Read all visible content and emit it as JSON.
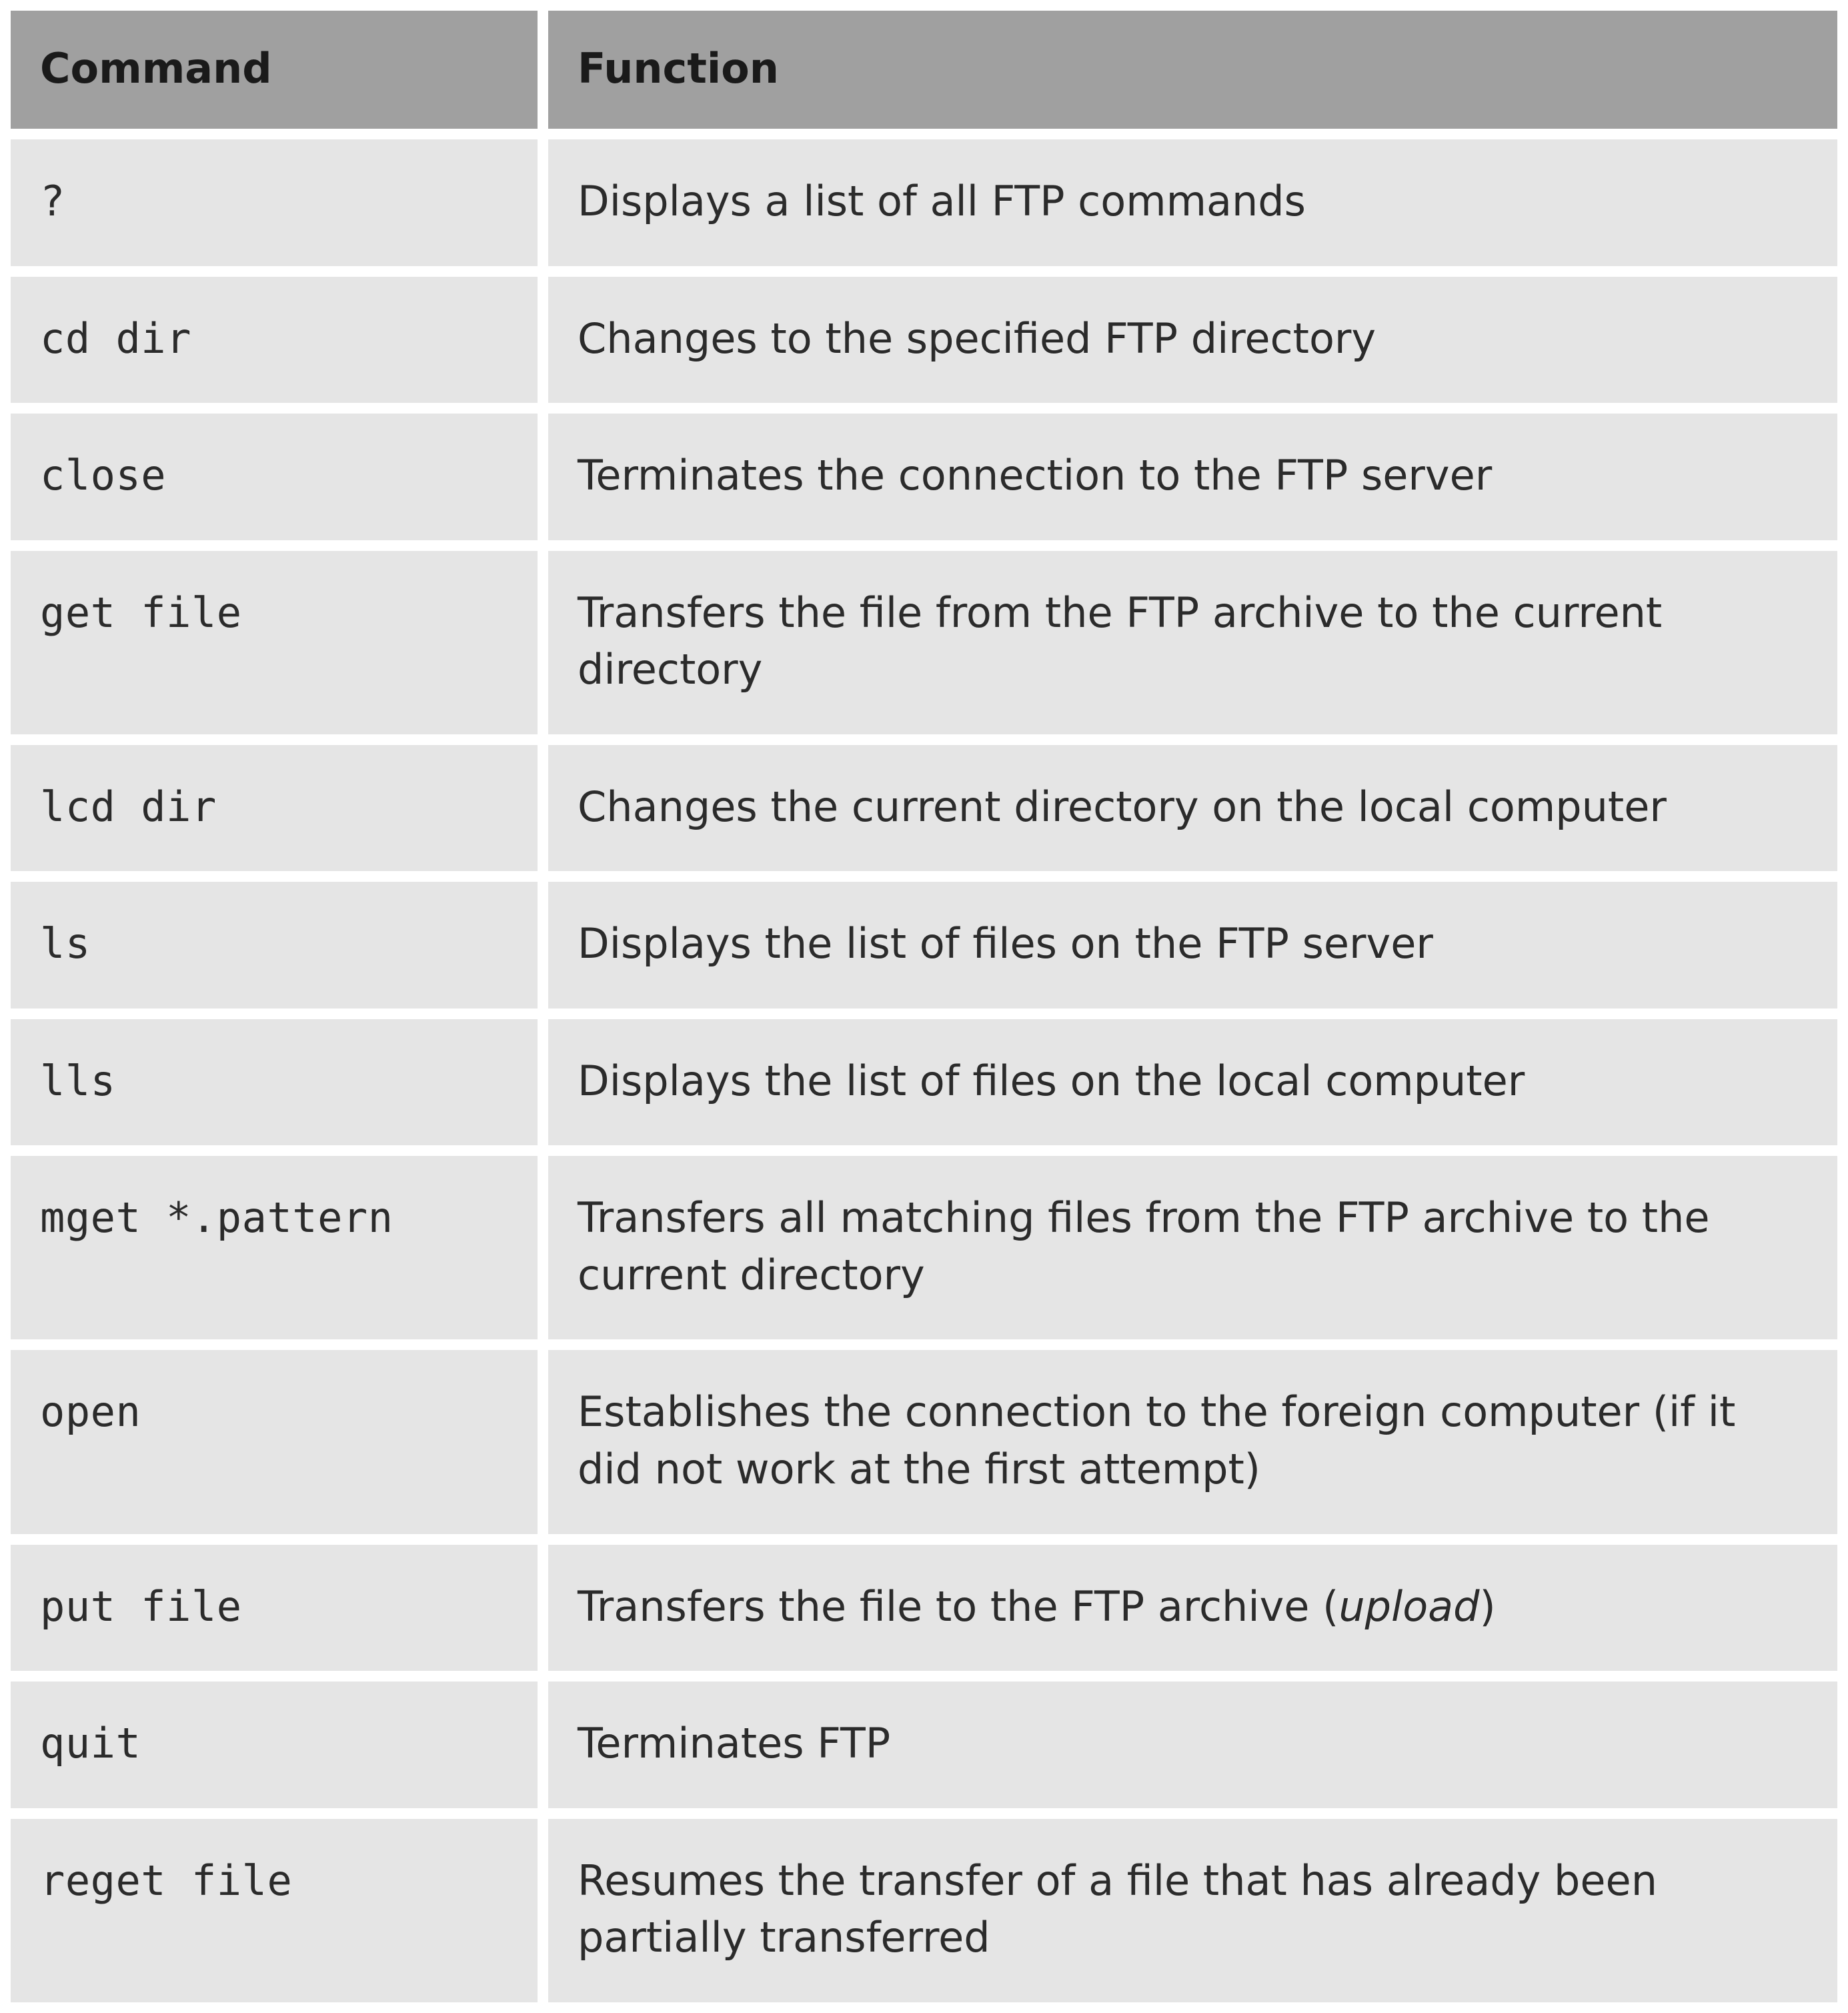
{
  "table": {
    "headers": {
      "command": "Command",
      "function": "Function"
    },
    "rows": [
      {
        "command": "?",
        "function_pre": "Displays a list of all FTP commands",
        "function_italic": "",
        "function_post": ""
      },
      {
        "command": "cd dir",
        "function_pre": "Changes to the specified FTP directory",
        "function_italic": "",
        "function_post": ""
      },
      {
        "command": "close",
        "function_pre": "Terminates the connection to the FTP server",
        "function_italic": "",
        "function_post": ""
      },
      {
        "command": "get file",
        "function_pre": "Transfers the file from the FTP archive to the current directory",
        "function_italic": "",
        "function_post": ""
      },
      {
        "command": "lcd dir",
        "function_pre": "Changes the current directory on the local computer",
        "function_italic": "",
        "function_post": ""
      },
      {
        "command": "ls",
        "function_pre": "Displays the list of files on the FTP server",
        "function_italic": "",
        "function_post": ""
      },
      {
        "command": "lls",
        "function_pre": "Displays the list of files on the local computer",
        "function_italic": "",
        "function_post": ""
      },
      {
        "command": "mget *.pattern",
        "function_pre": "Transfers all matching files from the FTP archive to the current directory",
        "function_italic": "",
        "function_post": ""
      },
      {
        "command": "open",
        "function_pre": "Establishes the connection to the foreign computer (if it did not work at the first attempt)",
        "function_italic": "",
        "function_post": ""
      },
      {
        "command": "put file",
        "function_pre": "Transfers the file to the FTP archive (",
        "function_italic": "upload",
        "function_post": ")"
      },
      {
        "command": "quit",
        "function_pre": "Terminates FTP",
        "function_italic": "",
        "function_post": ""
      },
      {
        "command": "reget file",
        "function_pre": "Resumes the transfer of a file that has already been partially transferred",
        "function_italic": "",
        "function_post": ""
      }
    ]
  }
}
